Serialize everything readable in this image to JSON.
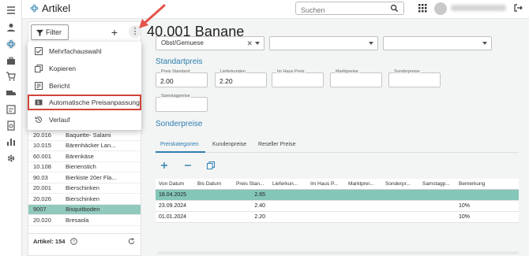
{
  "header": {
    "app_title": "Artikel",
    "search_placeholder": "Suchen"
  },
  "list_panel": {
    "filter_label": "Filter",
    "plus_label": "+",
    "more_label": "⋮",
    "menu": [
      {
        "icon": "checklist-icon",
        "label": "Mehrfachauswahl"
      },
      {
        "icon": "copy-icon",
        "label": "Kopieren"
      },
      {
        "icon": "report-icon",
        "label": "Bericht"
      },
      {
        "icon": "price-tag-icon",
        "label": "Automatische Preisanpassung",
        "highlighted": true
      },
      {
        "icon": "history-icon",
        "label": "Verlauf"
      }
    ],
    "rows": [
      {
        "nr": "20.016",
        "name": "Baquette- Salami"
      },
      {
        "nr": "10.015",
        "name": "Bärenhäcker Lan..."
      },
      {
        "nr": "60.001",
        "name": "Bärenkäse"
      },
      {
        "nr": "10.108",
        "name": "Bienenstich"
      },
      {
        "nr": "90.03",
        "name": "Bierkiste 20er Fla..."
      },
      {
        "nr": "20.001",
        "name": "Bierschinken"
      },
      {
        "nr": "20.026",
        "name": "Bierschinken"
      },
      {
        "nr": "9007",
        "name": "Bisquitboden",
        "selected": true
      },
      {
        "nr": "20.020",
        "name": "Bresaola"
      }
    ],
    "footer_count": "Artikel: 154"
  },
  "detail": {
    "title": "40.001 Banane",
    "category_select": "Obst/Gemuese",
    "standard_section": "Standartpreis",
    "fields": [
      {
        "label": "Preis Standard",
        "value": "2.00"
      },
      {
        "label": "Lieferkunden",
        "value": "2.20"
      },
      {
        "label": "Im Haus Preis",
        "value": ""
      },
      {
        "label": "Marktpreise",
        "value": ""
      },
      {
        "label": "Sonderpreise",
        "value": ""
      }
    ],
    "samstag_field": {
      "label": "Samstagpreise",
      "value": ""
    },
    "sonder_section": "Sonderpreise",
    "tabs": [
      "Preiskategorien",
      "Kundenpreise",
      "Reseller Preise"
    ],
    "table": {
      "headers": [
        "Von Datum",
        "Bis Datum",
        "Preis Stan...",
        "Lieferkun...",
        "Im Haus P...",
        "Marktprei...",
        "Sonderpr...",
        "Samstagp...",
        "Bemerkung"
      ],
      "rows": [
        {
          "cells": [
            "18.04.2025",
            "",
            "2.65",
            "",
            "",
            "",
            "",
            "",
            ""
          ],
          "selected": true
        },
        {
          "cells": [
            "23.09.2024",
            "",
            "2.40",
            "",
            "",
            "",
            "",
            "",
            "10%"
          ],
          "selected": false
        },
        {
          "cells": [
            "01.01.2024",
            "",
            "2.20",
            "",
            "",
            "",
            "",
            "",
            "10%"
          ],
          "selected": false
        }
      ]
    }
  },
  "colors": {
    "accent": "#2e7fb0",
    "selection": "#91c9bd",
    "highlight_border": "#d0453b",
    "annotation_arrow": "#e4544a"
  }
}
